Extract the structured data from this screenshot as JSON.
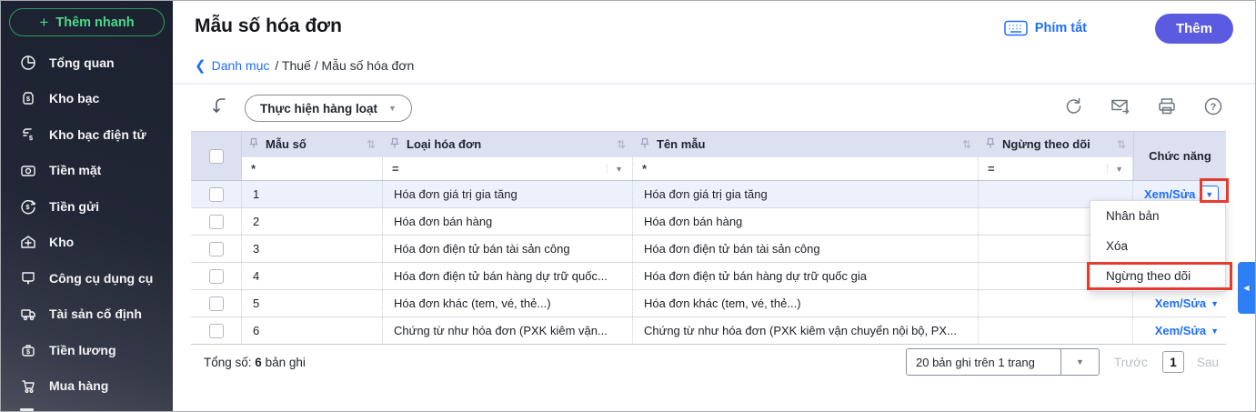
{
  "sidebar": {
    "quick_add_label": "Thêm nhanh",
    "items": [
      {
        "label": "Tổng quan",
        "icon": "pie-chart"
      },
      {
        "label": "Kho bạc",
        "icon": "treasury"
      },
      {
        "label": "Kho bạc điện tử",
        "icon": "e-treasury"
      },
      {
        "label": "Tiền mặt",
        "icon": "cash"
      },
      {
        "label": "Tiền gửi",
        "icon": "deposit"
      },
      {
        "label": "Kho",
        "icon": "warehouse"
      },
      {
        "label": "Công cụ dụng cụ",
        "icon": "tools"
      },
      {
        "label": "Tài sản cố định",
        "icon": "fixed-asset"
      },
      {
        "label": "Tiền lương",
        "icon": "payroll"
      },
      {
        "label": "Mua hàng",
        "icon": "shopping-cart"
      }
    ]
  },
  "header": {
    "title": "Mẫu số hóa đơn",
    "breadcrumb_back": "Danh mục",
    "breadcrumb_trail": "/ Thuế / Mẫu số hóa đơn",
    "shortcut_label": "Phím tắt",
    "add_button_label": "Thêm"
  },
  "toolbar": {
    "batch_button_label": "Thực hiện hàng loạt",
    "icons": [
      "refresh",
      "mail-send",
      "printer",
      "help"
    ]
  },
  "table": {
    "columns": {
      "mau_so": "Mẫu số",
      "loai_hoa_don": "Loại hóa đơn",
      "ten_mau": "Tên mẫu",
      "ngung_theo_doi": "Ngừng theo dõi",
      "chuc_nang": "Chức năng"
    },
    "filters": {
      "mau_so_op": "*",
      "loai_hoa_don_op": "=",
      "ten_mau_op": "*",
      "ngung_theo_doi_op": "="
    },
    "action_label": "Xem/Sửa",
    "rows": [
      {
        "mau_so": "1",
        "loai": "Hóa đơn giá trị gia tăng",
        "ten": "Hóa đơn giá trị gia tăng",
        "ngung": "",
        "action": "Xem/Sửa"
      },
      {
        "mau_so": "2",
        "loai": "Hóa đơn bán hàng",
        "ten": "Hóa đơn bán hàng",
        "ngung": "",
        "action": ""
      },
      {
        "mau_so": "3",
        "loai": "Hóa đơn điện tử bán tài sản công",
        "ten": "Hóa đơn điện tử bán tài sản công",
        "ngung": "",
        "action": ""
      },
      {
        "mau_so": "4",
        "loai": "Hóa đơn điện tử bán hàng dự trữ quốc...",
        "ten": "Hóa đơn điện tử bán hàng dự trữ quốc gia",
        "ngung": "",
        "action": ""
      },
      {
        "mau_so": "5",
        "loai": "Hóa đơn khác (tem, vé, thẻ...)",
        "ten": "Hóa đơn khác (tem, vé, thẻ...)",
        "ngung": "",
        "action": "Xem/Sửa"
      },
      {
        "mau_so": "6",
        "loai": "Chứng từ như hóa đơn (PXK kiêm vận...",
        "ten": "Chứng từ như hóa đơn (PXK kiêm vận chuyển nội bộ, PX...",
        "ngung": "",
        "action": "Xem/Sửa"
      }
    ]
  },
  "context_menu": {
    "items": [
      {
        "label": "Nhân bản"
      },
      {
        "label": "Xóa"
      },
      {
        "label": "Ngừng theo dõi"
      }
    ]
  },
  "footer": {
    "total_prefix": "Tổng số:",
    "total_count": "6",
    "total_suffix": "bản ghi",
    "page_size_label": "20 bản ghi trên 1 trang",
    "prev_label": "Trước",
    "page_number": "1",
    "next_label": "Sau"
  },
  "colors": {
    "accent_blue": "#1f6ff8",
    "add_button_bg": "#5a5be0",
    "quick_add_green": "#49d98b",
    "table_header_bg": "#dce0f0",
    "row_highlight": "#edf1fc",
    "annotation_red": "#e73b30",
    "edge_tab_blue": "#2e7ef6",
    "sidebar_bg_top": "#1c2130",
    "sidebar_bg_bottom": "#4a4f5c"
  }
}
